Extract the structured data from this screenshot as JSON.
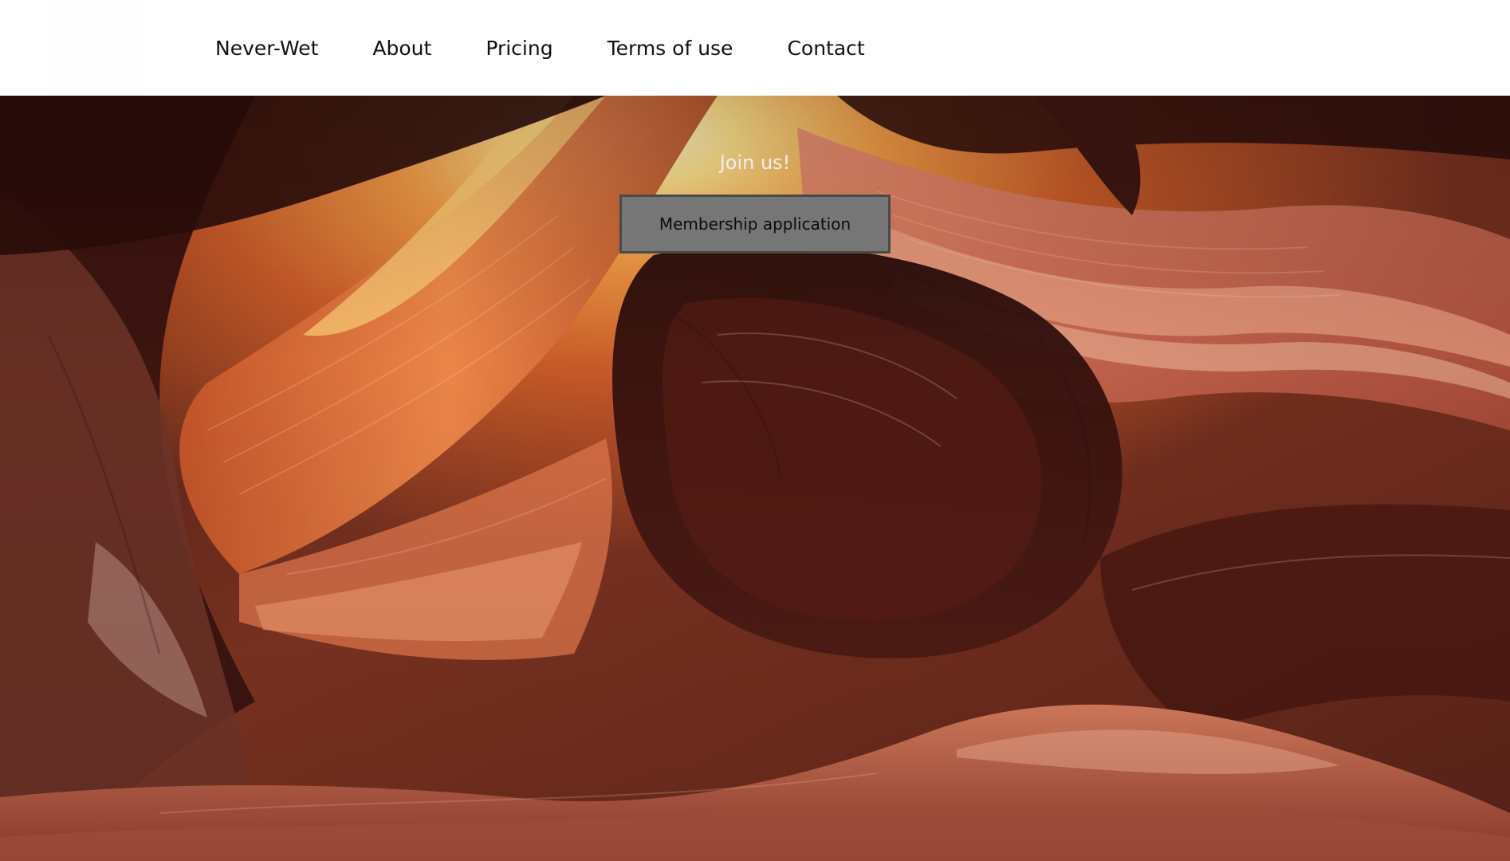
{
  "nav": {
    "items": [
      {
        "label": "Never-Wet"
      },
      {
        "label": "About"
      },
      {
        "label": "Pricing"
      },
      {
        "label": "Terms of use"
      },
      {
        "label": "Contact"
      }
    ]
  },
  "hero": {
    "image": "slot-canyon-sandstone-photo",
    "join_title": "Join us!",
    "cta_label": "Membership application"
  },
  "colors": {
    "header_bg": "#ffffff",
    "nav_text": "#111111",
    "button_bg": "#767676",
    "button_border": "#4a4a4a",
    "hero_text": "#f4eeea"
  }
}
